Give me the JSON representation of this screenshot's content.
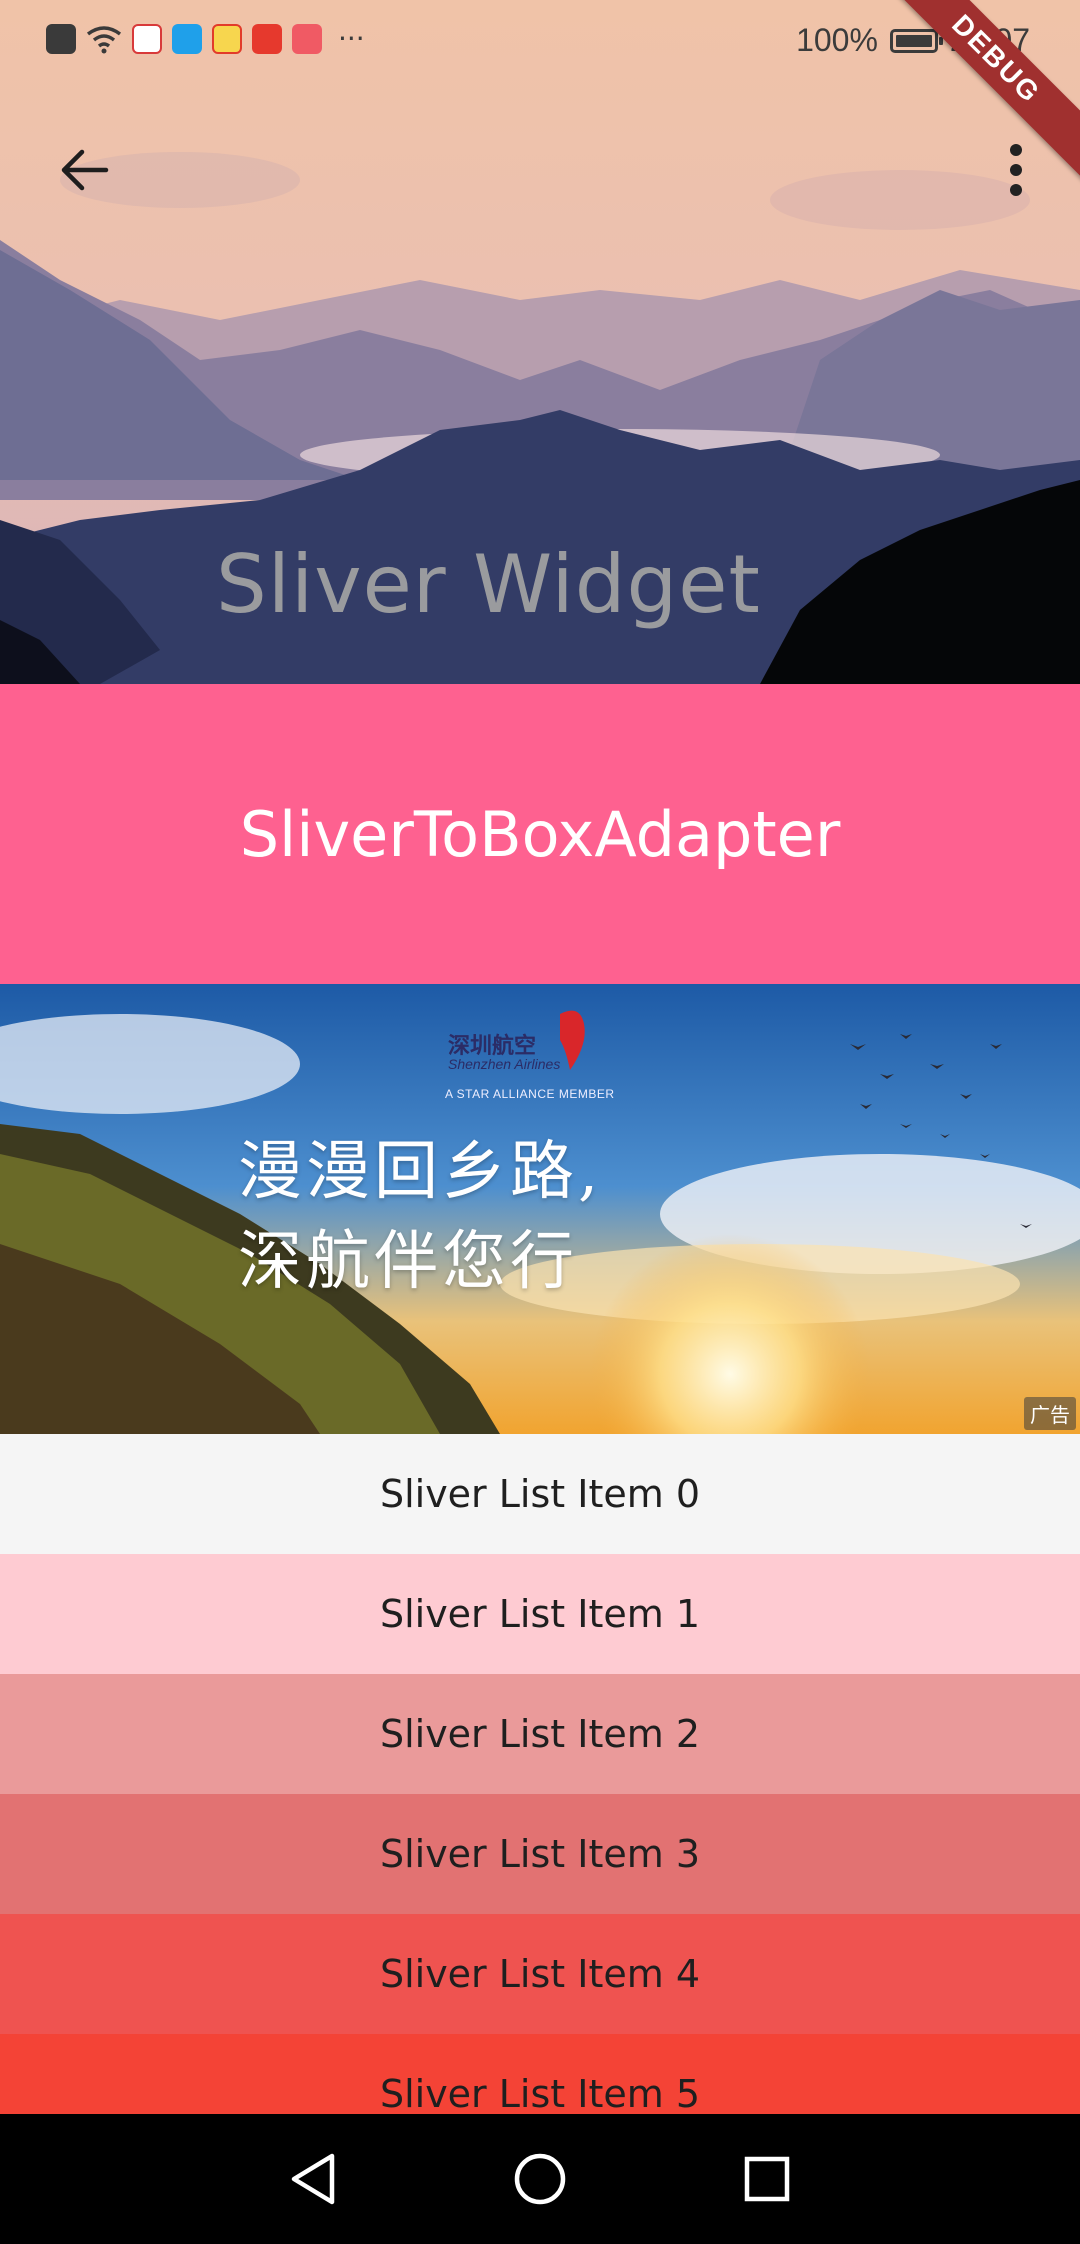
{
  "status_bar": {
    "battery_percent_text": "100%",
    "battery_level": 1.0,
    "time": "20:07",
    "notification_icons": [
      "alert-icon",
      "wifi-icon",
      "baidu-icon",
      "search-app-icon",
      "weibo-icon",
      "ting-icon",
      "reader-icon"
    ],
    "overflow": "···"
  },
  "debug_banner": "DEBUG",
  "app_bar": {
    "title": "Sliver Widget",
    "back_icon": "arrow-back-icon",
    "menu_icon": "more-vert-icon"
  },
  "adapter": {
    "text": "SliverToBoxAdapter",
    "color": "#fe6190"
  },
  "banner": {
    "brand_cn": "深圳航空",
    "brand_en": "Shenzhen Airlines",
    "alliance": "A STAR ALLIANCE MEMBER",
    "slogan_line1": "漫漫回乡路,",
    "slogan_line2": "深航伴您行",
    "ad_label": "广告"
  },
  "list": {
    "items": [
      {
        "label": "Sliver List Item 0",
        "color": "#f5f5f5"
      },
      {
        "label": "Sliver List Item 1",
        "color": "#fecbd2"
      },
      {
        "label": "Sliver List Item 2",
        "color": "#ea9a9a"
      },
      {
        "label": "Sliver List Item 3",
        "color": "#e27272"
      },
      {
        "label": "Sliver List Item 4",
        "color": "#ef5350"
      },
      {
        "label": "Sliver List Item 5",
        "color": "#f44336"
      }
    ]
  },
  "nav_bar": {
    "back": "nav-back-icon",
    "home": "nav-home-icon",
    "recents": "nav-recents-icon"
  }
}
